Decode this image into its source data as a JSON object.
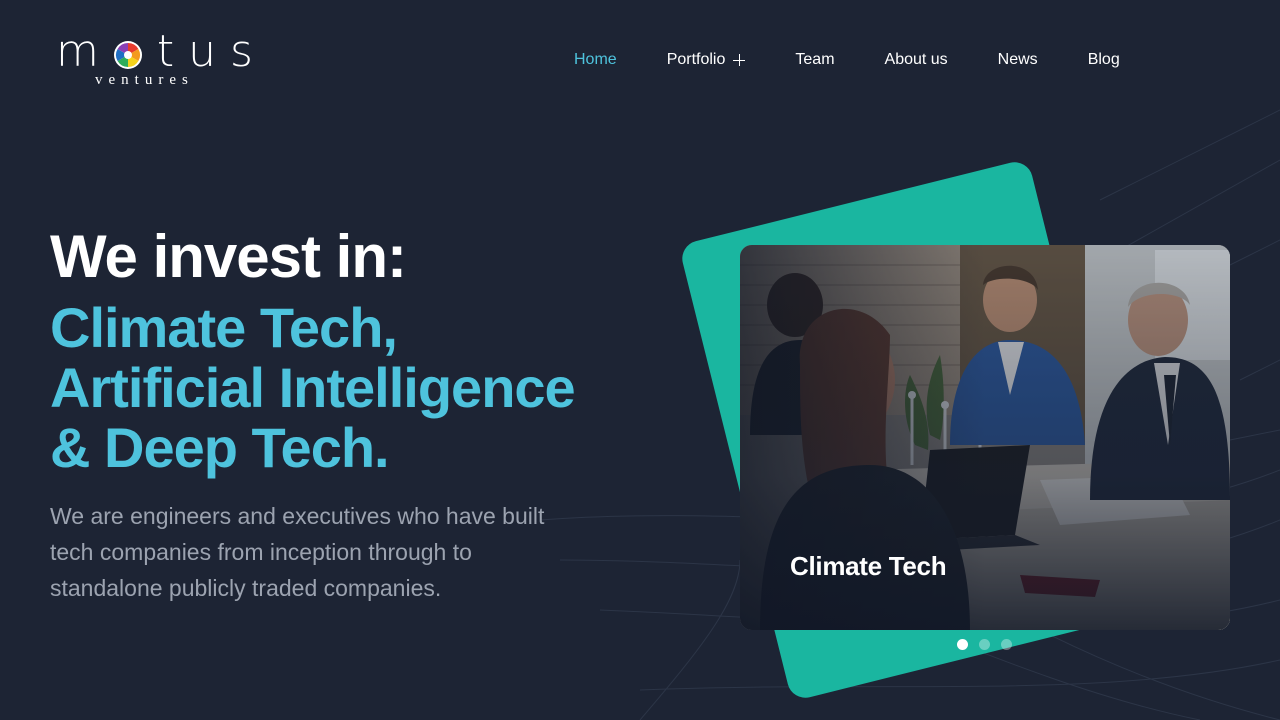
{
  "logo": {
    "word_start": "m",
    "word_end": "tus",
    "subtitle": "ventures",
    "icon": "color-wheel-icon"
  },
  "nav": {
    "items": [
      {
        "label": "Home",
        "active": true
      },
      {
        "label": "Portfolio",
        "has_submenu": true
      },
      {
        "label": "Team"
      },
      {
        "label": "About us"
      },
      {
        "label": "News"
      },
      {
        "label": "Blog"
      }
    ]
  },
  "hero": {
    "title": "We invest in:",
    "topics": [
      "Climate Tech,",
      "Artificial Intelligence",
      "& Deep Tech."
    ],
    "description": "We are engineers and executives who have built tech companies from inception through to standalone publicly traded companies."
  },
  "slider": {
    "caption": "Climate Tech",
    "slide_count": 3,
    "active_slide": 1
  },
  "colors": {
    "background": "#1d2434",
    "accent": "#4ec3dd",
    "teal": "#1ab6a0",
    "text_muted": "#9ca3b0"
  }
}
